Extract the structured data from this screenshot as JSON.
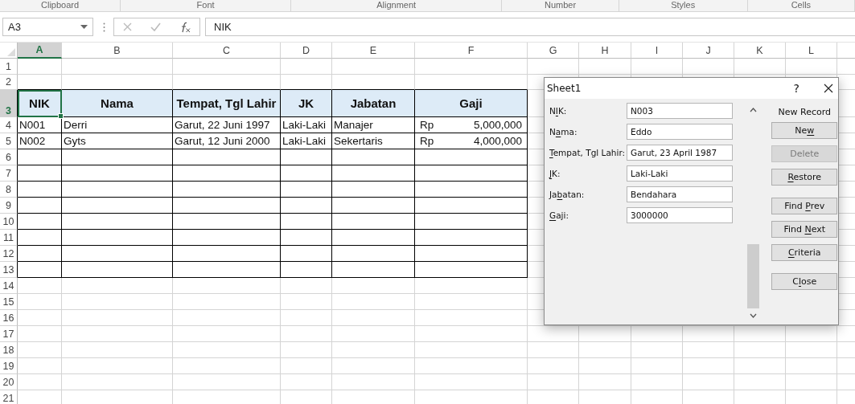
{
  "ribbon_groups": [
    "Clipboard",
    "Font",
    "Alignment",
    "Number",
    "Styles",
    "Cells"
  ],
  "name_box": {
    "value": "A3"
  },
  "formula_bar": {
    "value": "NIK"
  },
  "columns": [
    {
      "label": "A",
      "selected": true
    },
    {
      "label": "B",
      "selected": false
    },
    {
      "label": "C",
      "selected": false
    },
    {
      "label": "D",
      "selected": false
    },
    {
      "label": "E",
      "selected": false
    },
    {
      "label": "F",
      "selected": false
    },
    {
      "label": "G",
      "selected": false
    },
    {
      "label": "H",
      "selected": false
    },
    {
      "label": "I",
      "selected": false
    },
    {
      "label": "J",
      "selected": false
    },
    {
      "label": "K",
      "selected": false
    },
    {
      "label": "L",
      "selected": false
    }
  ],
  "rows": [
    {
      "label": "1",
      "selected": false
    },
    {
      "label": "2",
      "selected": false
    },
    {
      "label": "3",
      "selected": true
    },
    {
      "label": "4",
      "selected": false
    },
    {
      "label": "5",
      "selected": false
    },
    {
      "label": "6",
      "selected": false
    },
    {
      "label": "7",
      "selected": false
    },
    {
      "label": "8",
      "selected": false
    },
    {
      "label": "9",
      "selected": false
    },
    {
      "label": "10",
      "selected": false
    },
    {
      "label": "11",
      "selected": false
    },
    {
      "label": "12",
      "selected": false
    },
    {
      "label": "13",
      "selected": false
    },
    {
      "label": "14",
      "selected": false
    },
    {
      "label": "15",
      "selected": false
    },
    {
      "label": "16",
      "selected": false
    },
    {
      "label": "17",
      "selected": false
    },
    {
      "label": "18",
      "selected": false
    },
    {
      "label": "19",
      "selected": false
    },
    {
      "label": "20",
      "selected": false
    },
    {
      "label": "21",
      "selected": false
    }
  ],
  "table": {
    "headers": [
      {
        "text": "NIK",
        "selected": true
      },
      {
        "text": "Nama",
        "selected": false
      },
      {
        "text": "Tempat, Tgl Lahir",
        "selected": false
      },
      {
        "text": "JK",
        "selected": false
      },
      {
        "text": "Jabatan",
        "selected": false
      },
      {
        "text": "Gaji",
        "selected": false
      }
    ],
    "rows": [
      {
        "nik": "N001",
        "nama": "Derri",
        "ttl": "Garut, 22 Juni 1997",
        "jk": "Laki-Laki",
        "jabatan": "Manajer",
        "gaji": {
          "currency": "Rp",
          "amount": "5,000,000"
        }
      },
      {
        "nik": "N002",
        "nama": "Gyts",
        "ttl": "Garut, 12 Juni 2000",
        "jk": "Laki-Laki",
        "jabatan": "Sekertaris",
        "gaji": {
          "currency": "Rp",
          "amount": "4,000,000"
        }
      }
    ]
  },
  "dialog": {
    "title": "Sheet1",
    "help": "?",
    "status": "New Record",
    "fields": [
      {
        "label_parts": [
          {
            "text": "N",
            "underlined": false
          },
          {
            "text": "I",
            "underlined": true
          },
          {
            "text": "K:",
            "underlined": false
          }
        ],
        "value": "N003"
      },
      {
        "label_parts": [
          {
            "text": "N",
            "underlined": false
          },
          {
            "text": "a",
            "underlined": true
          },
          {
            "text": "ma:",
            "underlined": false
          }
        ],
        "value": "Eddo"
      },
      {
        "label_parts": [
          {
            "text": "T",
            "underlined": true
          },
          {
            "text": "empat, Tgl Lahir:",
            "underlined": false
          }
        ],
        "value": "Garut, 23 April 1987"
      },
      {
        "label_parts": [
          {
            "text": "J",
            "underlined": true
          },
          {
            "text": "K:",
            "underlined": false
          }
        ],
        "value": "Laki-Laki"
      },
      {
        "label_parts": [
          {
            "text": "Ja",
            "underlined": false
          },
          {
            "text": "b",
            "underlined": true
          },
          {
            "text": "atan:",
            "underlined": false
          }
        ],
        "value": "Bendahara"
      },
      {
        "label_parts": [
          {
            "text": "G",
            "underlined": true
          },
          {
            "text": "aji:",
            "underlined": false
          }
        ],
        "value": "3000000"
      }
    ],
    "button_groups": [
      [
        {
          "label_parts": [
            {
              "text": "Ne",
              "underlined": false
            },
            {
              "text": "w",
              "underlined": true
            }
          ],
          "disabled": false
        },
        {
          "label_parts": [
            {
              "text": "Delete",
              "underlined": false
            }
          ],
          "disabled": true
        },
        {
          "label_parts": [
            {
              "text": "R",
              "underlined": true
            },
            {
              "text": "estore",
              "underlined": false
            }
          ],
          "disabled": false
        }
      ],
      [
        {
          "label_parts": [
            {
              "text": "Find ",
              "underlined": false
            },
            {
              "text": "P",
              "underlined": true
            },
            {
              "text": "rev",
              "underlined": false
            }
          ],
          "disabled": false
        },
        {
          "label_parts": [
            {
              "text": "Find ",
              "underlined": false
            },
            {
              "text": "N",
              "underlined": true
            },
            {
              "text": "ext",
              "underlined": false
            }
          ],
          "disabled": false
        },
        {
          "label_parts": [
            {
              "text": "C",
              "underlined": true
            },
            {
              "text": "riteria",
              "underlined": false
            }
          ],
          "disabled": false
        }
      ],
      [
        {
          "label_parts": [
            {
              "text": "C",
              "underlined": false
            },
            {
              "text": "l",
              "underlined": true
            },
            {
              "text": "ose",
              "underlined": false
            }
          ],
          "disabled": false
        }
      ]
    ]
  }
}
